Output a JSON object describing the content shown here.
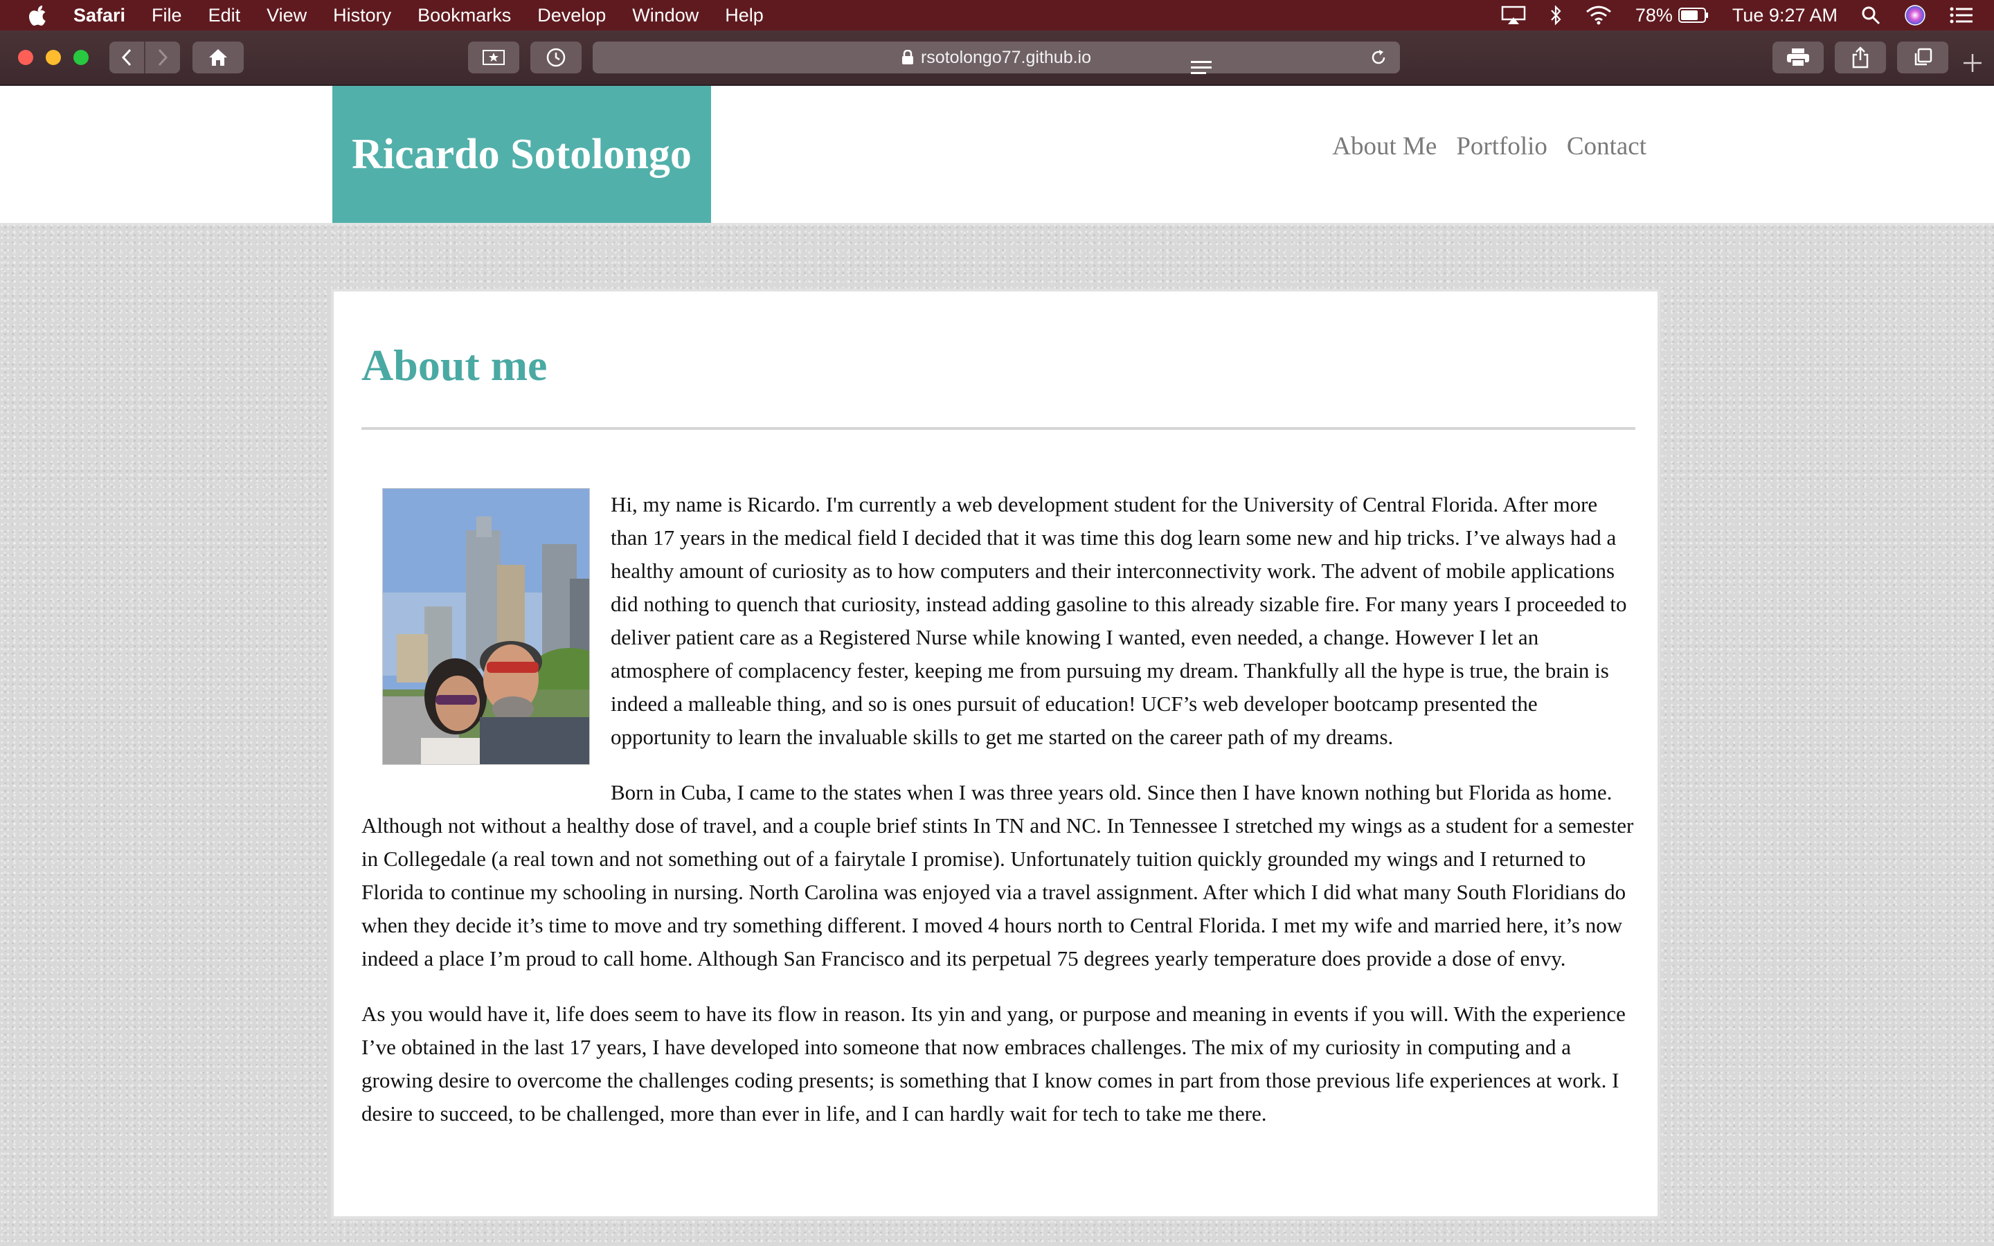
{
  "menubar": {
    "app": "Safari",
    "items": [
      "File",
      "Edit",
      "View",
      "History",
      "Bookmarks",
      "Develop",
      "Window",
      "Help"
    ],
    "battery": "78%",
    "clock": "Tue 9:27 AM"
  },
  "browser": {
    "url": "rsotolongo77.github.io"
  },
  "site": {
    "brand": "Ricardo Sotolongo",
    "nav": [
      "About Me",
      "Portfolio",
      "Contact"
    ]
  },
  "about": {
    "heading": "About me",
    "paragraphs": [
      "Hi, my name is Ricardo. I'm currently a web development student for the University of Central Florida. After more than 17 years in the medical field I decided that it was time this dog learn some new and hip tricks. I’ve always had a healthy amount of curiosity as to how computers and their interconnectivity work. The advent of mobile applications did nothing to quench that curiosity, instead adding gasoline to this already sizable fire. For many years I proceeded to deliver patient care as a Registered Nurse while knowing I wanted, even needed, a change. However I let an atmosphere of complacency fester, keeping me from pursuing my dream. Thankfully all the hype is true, the brain is indeed a malleable thing, and so is ones pursuit of education! UCF’s web developer bootcamp presented the opportunity to learn the invaluable skills to get me started on the career path of my dreams.",
      "Born in Cuba, I came to the states when I was three years old. Since then I have known nothing but Florida as home. Although not without a healthy dose of travel, and a couple brief stints In TN and NC. In Tennessee I stretched my wings as a student for a semester in Collegedale (a real town and not something out of a fairytale I promise). Unfortunately tuition quickly grounded my wings and I returned to Florida to continue my schooling in nursing. North Carolina was enjoyed via a travel assignment. After which I did what many South Floridians do when they decide it’s time to move and try something different. I moved 4 hours north to Central Florida. I met my wife and married here, it’s now indeed a place I’m proud to call home. Although San Francisco and its perpetual 75 degrees yearly temperature does provide a dose of envy.",
      "As you would have it, life does seem to have its flow in reason. Its yin and yang, or purpose and meaning in events if you will. With the experience I’ve obtained in the last 17 years, I have developed into someone that now embraces challenges. The mix of my curiosity in computing and a growing desire to overcome the challenges coding presents; is something that I know comes in part from those previous life experiences at work. I desire to succeed, to be challenged, more than ever in life, and I can hardly wait for tech to take me there."
    ]
  },
  "colors": {
    "accent": "#52b0aa",
    "menubar": "#5f1a1f"
  }
}
